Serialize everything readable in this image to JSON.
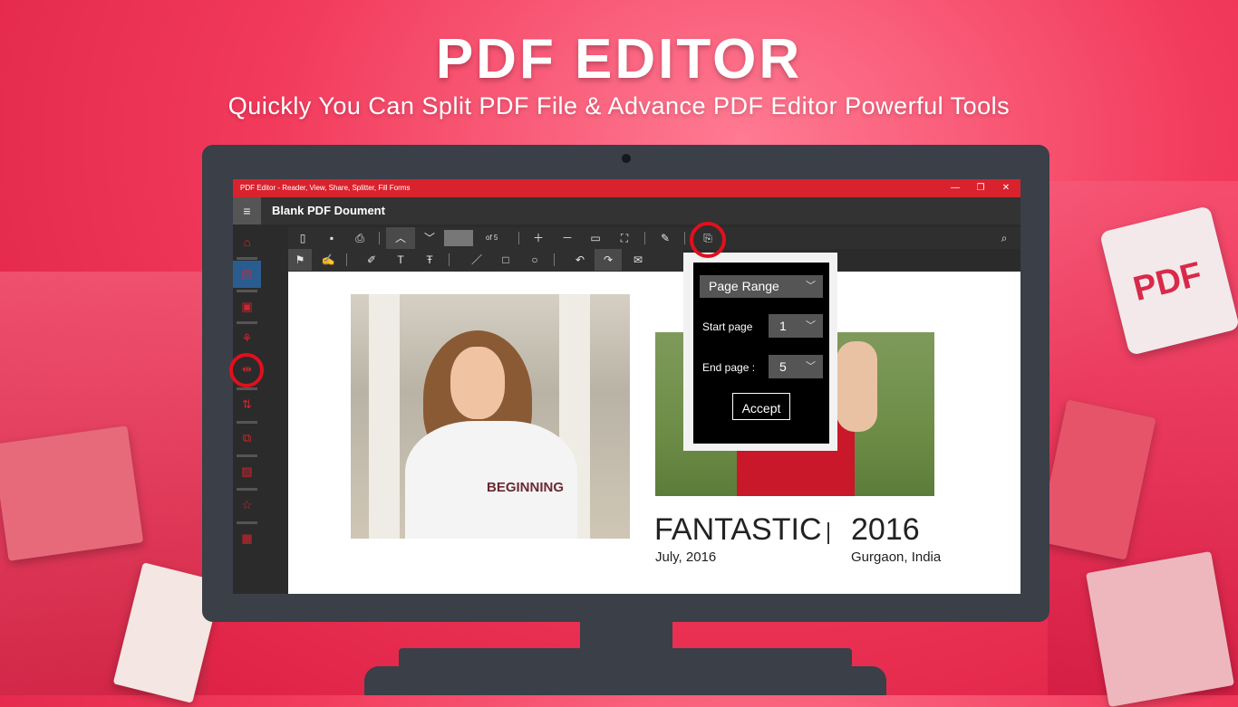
{
  "hero": {
    "title": "PDF EDITOR",
    "subtitle": "Quickly You Can Split PDF File & Advance PDF Editor Powerful Tools"
  },
  "decor": {
    "pdf_badge": "PDF"
  },
  "window": {
    "title": "PDF Editor - Reader, View, Share, Splitter, Fill Forms",
    "minimize": "—",
    "maximize": "❐",
    "close": "✕"
  },
  "appbar": {
    "menu_icon": "≡",
    "document_title": "Blank PDF Doument"
  },
  "toolbar": {
    "page_of": "of 5"
  },
  "document": {
    "photo_text": "BEGINNING",
    "heading": "FANTASTIC",
    "date": "July, 2016",
    "year": "2016",
    "location": "Gurgaon, India"
  },
  "split_dialog": {
    "range_mode": "Page Range",
    "start_label": "Start page",
    "start_value": "1",
    "end_label": "End page :",
    "end_value": "5",
    "accept_label": "Accept"
  },
  "colors": {
    "accent": "#d8232e",
    "highlight_ring": "#e0101e",
    "active_sidebar": "#2a5d8f"
  }
}
